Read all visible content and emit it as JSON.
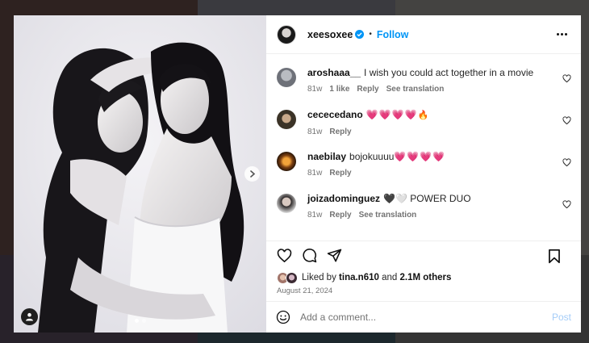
{
  "header": {
    "username": "xeesoxee",
    "follow_label": "Follow",
    "separator": "•"
  },
  "comments": [
    {
      "user": "aroshaaa__",
      "text": "I wish you could act together in a movie",
      "time": "81w",
      "likes": "1 like",
      "reply": "Reply",
      "translate": "See translation",
      "avatar_color": "#8a8e96"
    },
    {
      "user": "cececedano",
      "text": "",
      "emoji": "💗💗💗💗",
      "emoji2": "🔥",
      "time": "81w",
      "reply": "Reply",
      "avatar_color": "#3b3327"
    },
    {
      "user": "naebilay",
      "text": "bojokuuuu",
      "emoji": "💗💗💗💗",
      "time": "81w",
      "reply": "Reply",
      "avatar_color": "#c2741c"
    },
    {
      "user": "joizadominguez",
      "text": "🖤🤍 POWER DUO",
      "time": "81w",
      "reply": "Reply",
      "translate": "See translation",
      "avatar_color": "#2e2a2a"
    }
  ],
  "likes": {
    "prefix": "Liked by",
    "user": "tina.n610",
    "and": "and",
    "count": "2.1M others"
  },
  "date": "August 21, 2024",
  "add_comment": {
    "placeholder": "Add a comment...",
    "post_label": "Post"
  },
  "carousel": {
    "current": 1,
    "total": 2
  },
  "colors": {
    "accent": "#0095f6",
    "post_disabled": "#a5cdf8",
    "heart": "#ee3b6b",
    "verified": "#0095f6"
  }
}
